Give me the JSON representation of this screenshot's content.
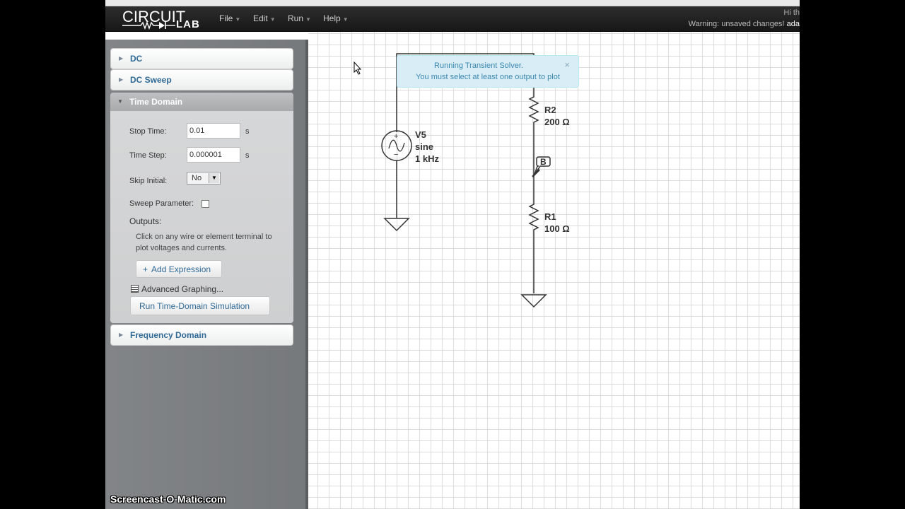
{
  "app": {
    "logo_top": "CIRCUIT",
    "logo_bottom": "LAB"
  },
  "menu": {
    "file": "File",
    "edit": "Edit",
    "run": "Run",
    "help": "Help"
  },
  "header": {
    "greeting": "Hi th",
    "warning": "Warning: unsaved changes!",
    "user": "ada"
  },
  "sidebar": {
    "dc": "DC",
    "dc_sweep": "DC Sweep",
    "time_domain": {
      "title": "Time Domain",
      "stop_time_label": "Stop Time:",
      "stop_time_value": "0.01",
      "stop_time_unit": "s",
      "time_step_label": "Time Step:",
      "time_step_value": "0.000001",
      "time_step_unit": "s",
      "skip_initial_label": "Skip Initial:",
      "skip_initial_value": "No",
      "sweep_parameter_label": "Sweep Parameter:",
      "outputs_label": "Outputs:",
      "outputs_help": "Click on any wire or element terminal to plot voltages and currents.",
      "add_expression": "Add Expression",
      "advanced_graphing": "Advanced Graphing...",
      "run_button": "Run Time-Domain Simulation"
    },
    "frequency_domain": "Frequency Domain"
  },
  "notification": {
    "line1": "Running Transient Solver.",
    "line2": "You must select at least one output to plot",
    "close": "×"
  },
  "schematic": {
    "source": {
      "name": "V5",
      "type": "sine",
      "freq": "1 kHz"
    },
    "r2": {
      "name": "R2",
      "value": "200 Ω"
    },
    "r1": {
      "name": "R1",
      "value": "100 Ω"
    },
    "probe": "B"
  },
  "watermark": "Screencast-O-Matic.com"
}
